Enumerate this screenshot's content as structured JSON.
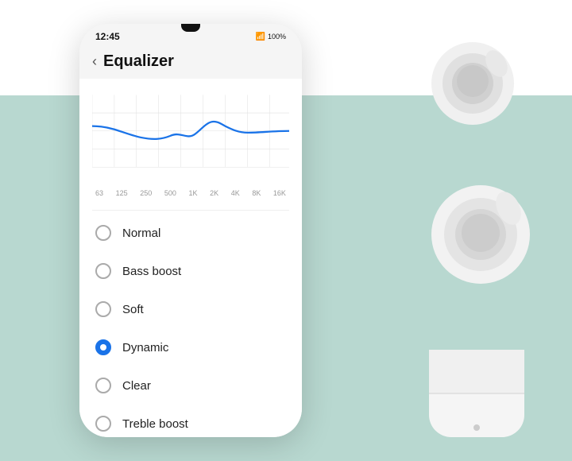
{
  "status_bar": {
    "time": "12:45",
    "battery": "100%"
  },
  "header": {
    "back_label": "‹",
    "title": "Equalizer"
  },
  "eq_chart": {
    "labels": [
      "63",
      "125",
      "250",
      "500",
      "1K",
      "2K",
      "4K",
      "8K",
      "16K"
    ]
  },
  "options": [
    {
      "id": "normal",
      "label": "Normal",
      "selected": false
    },
    {
      "id": "bass-boost",
      "label": "Bass boost",
      "selected": false
    },
    {
      "id": "soft",
      "label": "Soft",
      "selected": false
    },
    {
      "id": "dynamic",
      "label": "Dynamic",
      "selected": true
    },
    {
      "id": "clear",
      "label": "Clear",
      "selected": false
    },
    {
      "id": "treble-boost",
      "label": "Treble boost",
      "selected": false
    }
  ]
}
